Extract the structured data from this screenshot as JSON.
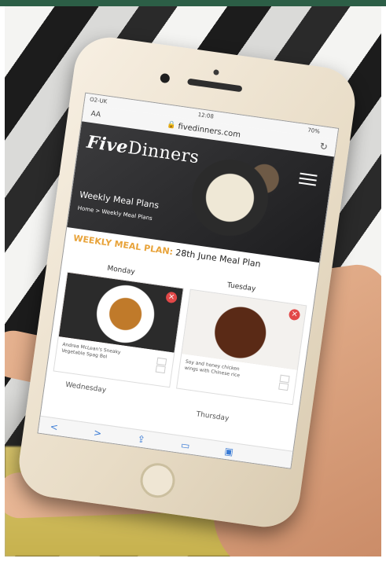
{
  "status": {
    "carrier": "O2-UK",
    "time": "12:08",
    "battery": "70%"
  },
  "browser": {
    "aa": "AA",
    "address": "fivedinners.com",
    "reload_icon": "reload-icon",
    "lock_icon": "lock-icon"
  },
  "site": {
    "logo_five": "Five",
    "logo_dinners": "Dinners",
    "hero_title": "Weekly Meal Plans",
    "breadcrumb": "Home > Weekly Meal Plans"
  },
  "plan": {
    "label": "WEEKLY MEAL PLAN:",
    "title": "28th June Meal Plan"
  },
  "days": {
    "monday": {
      "name": "Monday",
      "caption": "Andrea McLean's Sneaky Vegetable Spag Bol",
      "remove": "×"
    },
    "tuesday": {
      "name": "Tuesday",
      "caption": "Soy and honey chicken wings with Chinese rice",
      "remove": "×"
    },
    "wednesday": "Wednesday",
    "thursday": "Thursday"
  },
  "toolbar": {
    "back": "<",
    "forward": ">",
    "share": "⇪",
    "bookmarks": "▭",
    "tabs": "▣"
  },
  "colors": {
    "accent": "#e8a33a",
    "remove": "#e24848",
    "topbar": "#2c5e46"
  }
}
